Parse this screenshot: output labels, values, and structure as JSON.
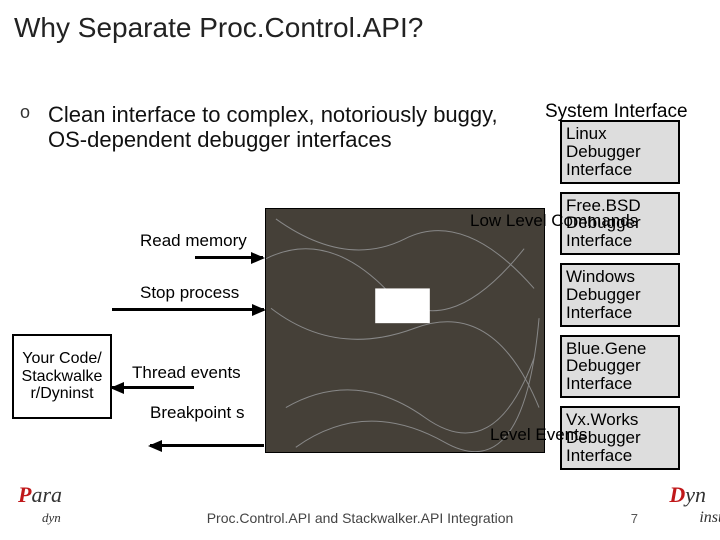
{
  "title": "Why Separate Proc.Control.API?",
  "bullet": {
    "mark": "o",
    "text": "Clean interface to complex, notoriously buggy, OS-dependent debugger interfaces"
  },
  "sys_label": "System Interface",
  "right_boxes": [
    "Linux Debugger Interface",
    "Free.BSD Debugger Interface",
    "Windows Debugger Interface",
    "Blue.Gene Debugger Interface",
    "Vx.Works Debugger Interface"
  ],
  "left_box": "Your Code/ Stackwalke r/Dyninst",
  "labels": {
    "read_memory": "Read memory",
    "stop_process": "Stop process",
    "thread_events": "Thread events",
    "breakpoints": "Breakpoint s",
    "low_level_cmd": "Low Level Commands",
    "level_events": "Level Events"
  },
  "footer": {
    "title": "Proc.Control.API and Stackwalker.API Integration",
    "page": "7",
    "logo_left_a": "P",
    "logo_left_b": "ara",
    "logo_left_c": "dyn",
    "logo_right_a": "D",
    "logo_right_b": "yn",
    "logo_right_c": "inst"
  }
}
